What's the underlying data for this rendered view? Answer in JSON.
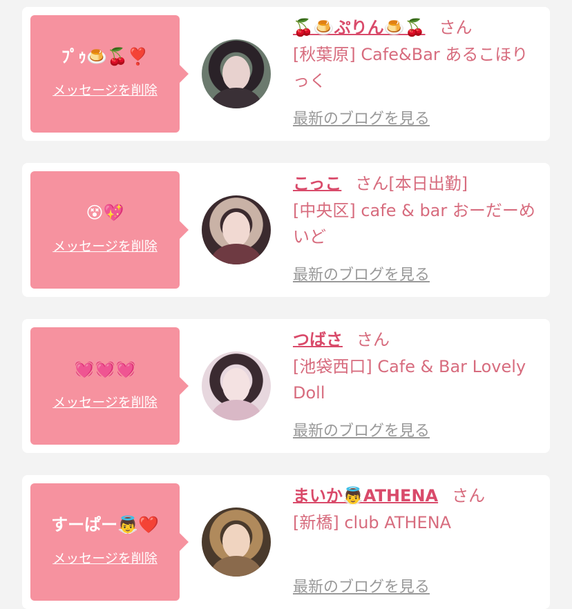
{
  "cards": [
    {
      "message": "ﾌﾟｩ🍮🍒❣️",
      "delete_label": "メッセージを削除",
      "name": "🍒🍮ぷりん🍮🍒",
      "honorific": "さん",
      "shop": "[秋葉原] Cafe&Bar あるこほりっく",
      "blog_label": "最新のブログを見る",
      "avatar_colors": {
        "bg": "#6b7a6e",
        "hair": "#2a2228",
        "face": "#e8d2cf",
        "body": "#3a3036"
      }
    },
    {
      "message": "😵💖",
      "delete_label": "メッセージを削除",
      "name": "こっこ",
      "honorific": "さん[本日出勤]",
      "shop": "[中央区] cafe & bar おーだーめいど",
      "blog_label": "最新のブログを見る",
      "avatar_colors": {
        "bg": "#3b2a2e",
        "hair": "#c9b2a6",
        "face": "#f1d9d2",
        "body": "#6e3a42"
      }
    },
    {
      "message": "💓💓💓",
      "delete_label": "メッセージを削除",
      "name": "つばさ",
      "honorific": "さん",
      "shop": "[池袋西口] Cafe & Bar Lovely Doll",
      "blog_label": "最新のブログを見る",
      "avatar_colors": {
        "bg": "#e7d7de",
        "hair": "#3a2a30",
        "face": "#f4e2e2",
        "body": "#d9b8c6"
      }
    },
    {
      "message": "すーぱー👼❤️",
      "delete_label": "メッセージを削除",
      "name": "まいか👼ATHENA",
      "honorific": "さん",
      "shop": "[新橋] club ATHENA",
      "blog_label": "最新のブログを見る",
      "avatar_colors": {
        "bg": "#4a3a2c",
        "hair": "#b08a5c",
        "face": "#f0d4c0",
        "body": "#8a6a4c"
      }
    }
  ]
}
